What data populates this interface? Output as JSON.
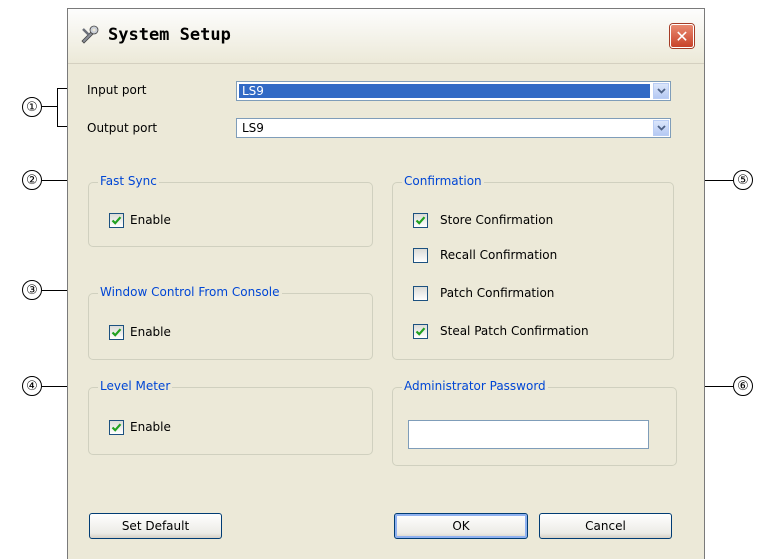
{
  "window": {
    "title": "System Setup",
    "icon": "wrench-tools-icon",
    "close_icon": "close-icon"
  },
  "ports": {
    "input_label": "Input port",
    "input_value": "LS9",
    "output_label": "Output port",
    "output_value": "LS9"
  },
  "fast_sync": {
    "legend": "Fast Sync",
    "checkbox_label": "Enable",
    "checked": true
  },
  "window_control": {
    "legend": "Window Control From Console",
    "checkbox_label": "Enable",
    "checked": true
  },
  "level_meter": {
    "legend": "Level Meter",
    "checkbox_label": "Enable",
    "checked": true
  },
  "confirmation": {
    "legend": "Confirmation",
    "items": [
      {
        "label": "Store Confirmation",
        "checked": true
      },
      {
        "label": "Recall Confirmation",
        "checked": false
      },
      {
        "label": "Patch Confirmation",
        "checked": false
      },
      {
        "label": "Steal Patch Confirmation",
        "checked": true
      }
    ]
  },
  "admin": {
    "legend": "Administrator Password",
    "value": ""
  },
  "buttons": {
    "set_default": "Set Default",
    "ok": "OK",
    "cancel": "Cancel"
  },
  "callouts": [
    "①",
    "②",
    "③",
    "④",
    "⑤",
    "⑥"
  ],
  "colors": {
    "legend": "#0046d5",
    "selection": "#316ac5",
    "close": "#c8422a"
  }
}
